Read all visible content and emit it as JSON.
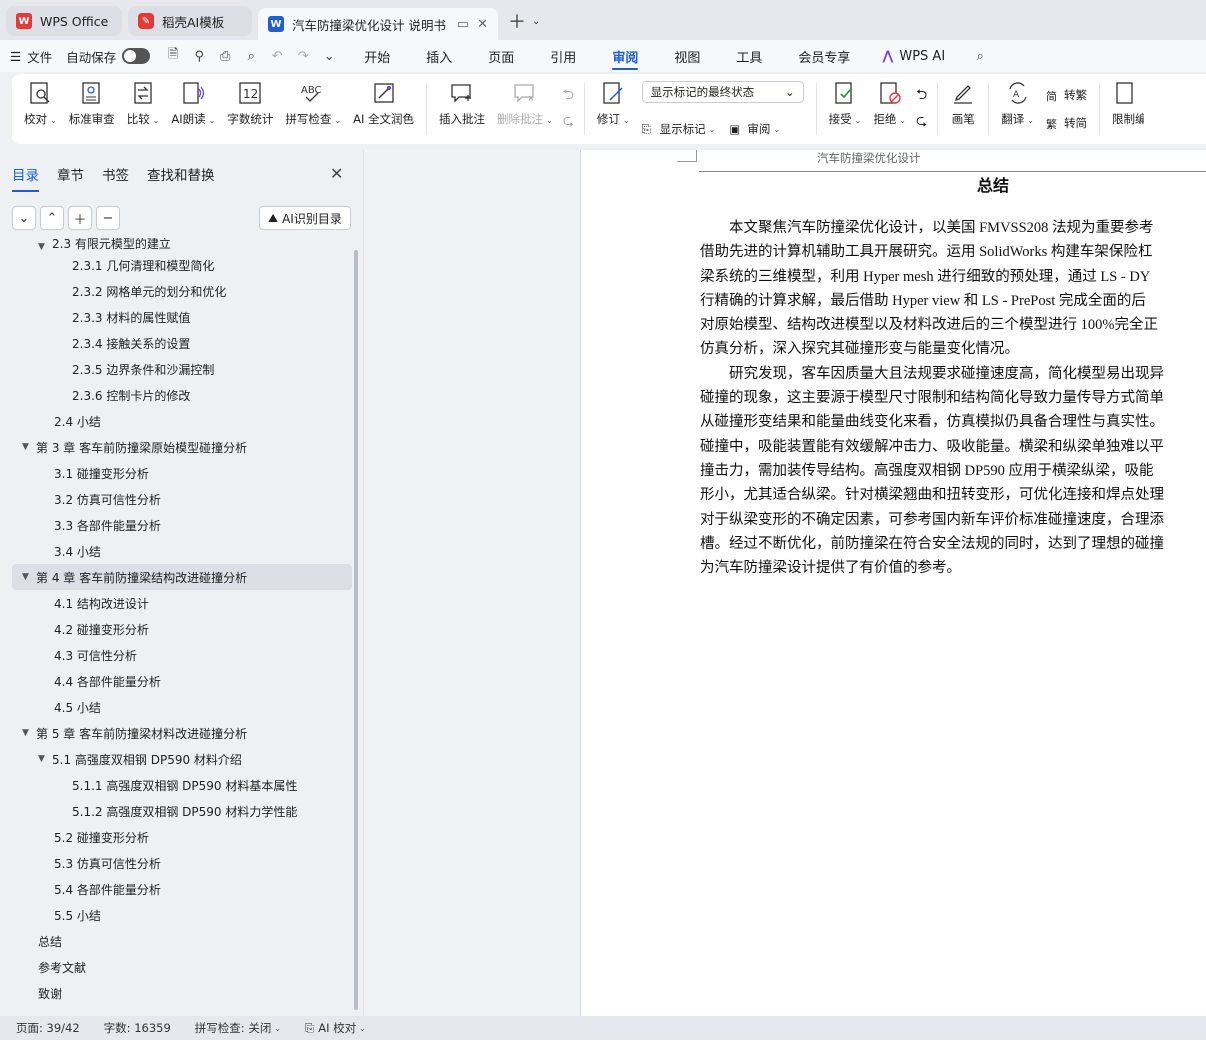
{
  "tabs": [
    {
      "label": "WPS Office",
      "icon": "wps-logo-icon"
    },
    {
      "label": "稻壳AI模板",
      "icon": "docer-logo-icon"
    },
    {
      "label": "汽车防撞梁优化设计 说明书",
      "icon": "word-doc-icon"
    }
  ],
  "menu": {
    "file": "文件",
    "autosave": "自动保存",
    "tabs": [
      "开始",
      "插入",
      "页面",
      "引用",
      "审阅",
      "视图",
      "工具",
      "会员专享"
    ],
    "active_tab": "审阅",
    "wps_ai": "WPS AI"
  },
  "ribbon": {
    "proofread": "校对",
    "standard_review": "标准审查",
    "compare": "比较",
    "ai_read": "AI朗读",
    "word_count": "字数统计",
    "word_count_icon_text": "12",
    "spell_check": "拼写检查",
    "spell_icon_text": "ABC",
    "ai_proofread": "AI 全文润色",
    "insert_comment": "插入批注",
    "delete_comment": "删除批注",
    "track": "修订",
    "display_state": "显示标记的最终状态",
    "show_markup": "显示标记",
    "review": "审阅",
    "accept": "接受",
    "reject": "拒绝",
    "pen": "画笔",
    "translate": "翻译",
    "to_traditional": "转繁",
    "to_simplified": "转简",
    "restrict": "限制编辑",
    "to_traditional_glyph": "简",
    "to_simplified_glyph": "繁"
  },
  "nav": {
    "tabs": [
      "目录",
      "章节",
      "书签",
      "查找和替换"
    ],
    "active": "目录",
    "ai_toc": "AI识别目录",
    "items": [
      {
        "text": "2.3 有限元模型的建立",
        "level": 2,
        "arrow": "▼",
        "partial": true
      },
      {
        "text": "2.3.1 几何清理和模型简化",
        "level": 3
      },
      {
        "text": "2.3.2 网格单元的划分和优化",
        "level": 3
      },
      {
        "text": "2.3.3 材料的属性赋值",
        "level": 3
      },
      {
        "text": "2.3.4 接触关系的设置",
        "level": 3
      },
      {
        "text": "2.3.5 边界条件和沙漏控制",
        "level": 3
      },
      {
        "text": "2.3.6 控制卡片的修改",
        "level": 3
      },
      {
        "text": "2.4 小结",
        "level": 2
      },
      {
        "text": "第 3 章  客车前防撞梁原始模型碰撞分析",
        "level": 1,
        "arrow": "▼"
      },
      {
        "text": "3.1 碰撞变形分析",
        "level": 2
      },
      {
        "text": "3.2 仿真可信性分析",
        "level": 2
      },
      {
        "text": "3.3 各部件能量分析",
        "level": 2
      },
      {
        "text": "3.4 小结",
        "level": 2
      },
      {
        "text": "第 4 章  客车前防撞梁结构改进碰撞分析",
        "level": 1,
        "arrow": "▼",
        "active": true
      },
      {
        "text": "4.1 结构改进设计",
        "level": 2
      },
      {
        "text": "4.2 碰撞变形分析",
        "level": 2
      },
      {
        "text": "4.3 可信性分析",
        "level": 2
      },
      {
        "text": "4.4 各部件能量分析",
        "level": 2
      },
      {
        "text": "4.5 小结",
        "level": 2
      },
      {
        "text": "第 5 章  客车前防撞梁材料改进碰撞分析",
        "level": 1,
        "arrow": "▼"
      },
      {
        "text": "5.1 高强度双相钢 DP590 材料介绍",
        "level": 2,
        "arrow": "▼"
      },
      {
        "text": "5.1.1 高强度双相钢 DP590 材料基本属性",
        "level": 3
      },
      {
        "text": "5.1.2 高强度双相钢 DP590 材料力学性能",
        "level": 3
      },
      {
        "text": "5.2 碰撞变形分析",
        "level": 2
      },
      {
        "text": "5.3 仿真可信性分析",
        "level": 2
      },
      {
        "text": "5.4 各部件能量分析",
        "level": 2
      },
      {
        "text": "5.5 小结",
        "level": 2
      },
      {
        "text": "总结",
        "level": 1
      },
      {
        "text": "参考文献",
        "level": 1
      },
      {
        "text": "致谢",
        "level": 1
      }
    ]
  },
  "document": {
    "header": "汽车防撞梁优化设计",
    "title": "总结",
    "lines": [
      "　　本文聚焦汽车防撞梁优化设计，以美国 FMVSS208 法规为重要参考",
      "借助先进的计算机辅助工具开展研究。运用 SolidWorks 构建车架保险杠",
      "梁系统的三维模型，利用 Hyper mesh 进行细致的预处理，通过 LS - DY",
      "行精确的计算求解，最后借助 Hyper view 和 LS - PrePost 完成全面的后",
      "对原始模型、结构改进模型以及材料改进后的三个模型进行 100%完全正",
      "仿真分析，深入探究其碰撞形变与能量变化情况。",
      "　　研究发现，客车因质量大且法规要求碰撞速度高，简化模型易出现异",
      "碰撞的现象，这主要源于模型尺寸限制和结构简化导致力量传导方式简单",
      "从碰撞形变结果和能量曲线变化来看，仿真模拟仍具备合理性与真实性。",
      "碰撞中，吸能装置能有效缓解冲击力、吸收能量。横梁和纵梁单独难以平",
      "撞击力，需加装传导结构。高强度双相钢 DP590 应用于横梁纵梁，吸能",
      "形小，尤其适合纵梁。针对横梁翘曲和扭转变形，可优化连接和焊点处理",
      "对于纵梁变形的不确定因素，可参考国内新车评价标准碰撞速度，合理添",
      "槽。经过不断优化，前防撞梁在符合安全法规的同时，达到了理想的碰撞",
      "为汽车防撞梁设计提供了有价值的参考。"
    ]
  },
  "status": {
    "page": "页面: 39/42",
    "words": "字数: 16359",
    "spell": "拼写检查: 关闭",
    "ai_proof": "AI 校对"
  }
}
